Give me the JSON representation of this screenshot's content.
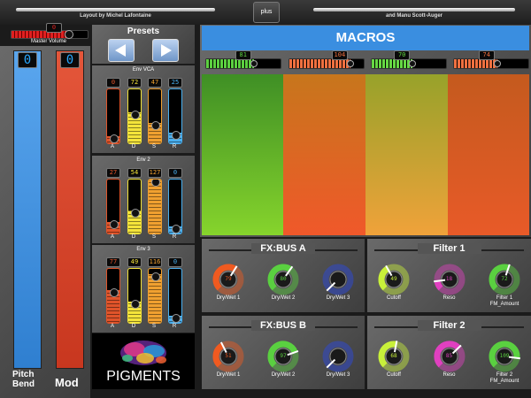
{
  "header": {
    "left_text": "Layout by Michel Lafontaine",
    "right_text": "and Manu Scott-Auger",
    "plus_label": "plus"
  },
  "master": {
    "label": "Master Volume",
    "value": "0",
    "fraction": 0.75
  },
  "pitch": {
    "value": "0",
    "label_line1": "Pitch",
    "label_line2": "Bend",
    "color": "#3b8fdc"
  },
  "mod": {
    "value": "0",
    "label": "Mod",
    "color": "#d8472e"
  },
  "presets": {
    "title": "Presets",
    "prev_icon": "arrow-left-icon",
    "next_icon": "arrow-right-icon"
  },
  "envelopes": [
    {
      "title": "Env VCA",
      "faders": [
        {
          "letter": "A",
          "value": "0",
          "fraction": 0.0,
          "color": "#e0542a"
        },
        {
          "letter": "D",
          "value": "72",
          "fraction": 0.57,
          "color": "#f4e43a"
        },
        {
          "letter": "S",
          "value": "47",
          "fraction": 0.37,
          "color": "#f0a030"
        },
        {
          "letter": "R",
          "value": "25",
          "fraction": 0.2,
          "color": "#4ab0f0"
        }
      ]
    },
    {
      "title": "Env 2",
      "faders": [
        {
          "letter": "A",
          "value": "27",
          "fraction": 0.21,
          "color": "#e0542a"
        },
        {
          "letter": "D",
          "value": "54",
          "fraction": 0.43,
          "color": "#f4e43a"
        },
        {
          "letter": "S",
          "value": "127",
          "fraction": 1.0,
          "color": "#f0a030"
        },
        {
          "letter": "R",
          "value": "0",
          "fraction": 0.0,
          "color": "#4ab0f0"
        }
      ]
    },
    {
      "title": "Env 3",
      "faders": [
        {
          "letter": "A",
          "value": "77",
          "fraction": 0.61,
          "color": "#e0542a"
        },
        {
          "letter": "D",
          "value": "49",
          "fraction": 0.39,
          "color": "#f4e43a"
        },
        {
          "letter": "S",
          "value": "116",
          "fraction": 0.91,
          "color": "#f0a030"
        },
        {
          "letter": "R",
          "value": "0",
          "fraction": 0.0,
          "color": "#4ab0f0"
        }
      ]
    }
  ],
  "logo": {
    "text": "PIGMENTS"
  },
  "macros": {
    "title": "MACROS",
    "title_bg": "#3a8ee0",
    "items": [
      {
        "value": "81",
        "fraction": 0.64,
        "color": "#5cd040"
      },
      {
        "value": "104",
        "fraction": 0.82,
        "color": "#f07040"
      },
      {
        "value": "70",
        "fraction": 0.55,
        "color": "#66d844"
      },
      {
        "value": "74",
        "fraction": 0.58,
        "color": "#f07040"
      }
    ],
    "pads": [
      {
        "top": "#3f8f25",
        "bottom": "#86d42c"
      },
      {
        "top": "#c7761c",
        "bottom": "#f0582a"
      },
      {
        "top": "#97a22a",
        "bottom": "#f0a23a"
      },
      {
        "top": "#c45a1e",
        "bottom": "#e85a28"
      }
    ]
  },
  "fx_bus_a": {
    "title": "FX:BUS A",
    "knobs": [
      {
        "label": "Dry/Wet 1",
        "value": "79",
        "fraction": 0.62,
        "color": "#f05a20"
      },
      {
        "label": "Dry/Wet 2",
        "value": "80",
        "fraction": 0.63,
        "color": "#5ad040"
      },
      {
        "label": "Dry/Wet 3",
        "value": "",
        "fraction": 0.0,
        "color": "#2a4ae8"
      }
    ]
  },
  "filter_1": {
    "title": "Filter 1",
    "knobs": [
      {
        "label": "Cutoff",
        "value": "49",
        "fraction": 0.39,
        "color": "#c8f03a"
      },
      {
        "label": "Reso",
        "value": "18",
        "fraction": 0.14,
        "color": "#e040c0"
      },
      {
        "label": "Filter 1 FM_Amount",
        "value": "72",
        "fraction": 0.57,
        "color": "#5ad040"
      }
    ]
  },
  "fx_bus_b": {
    "title": "FX:BUS B",
    "knobs": [
      {
        "label": "Dry/Wet 1",
        "value": "51",
        "fraction": 0.4,
        "color": "#f05a20"
      },
      {
        "label": "Dry/Wet 2",
        "value": "97",
        "fraction": 0.76,
        "color": "#5ad040"
      },
      {
        "label": "Dry/Wet 3",
        "value": "",
        "fraction": 0.0,
        "color": "#2a4ae8"
      }
    ]
  },
  "filter_2": {
    "title": "Filter 2",
    "knobs": [
      {
        "label": "Cutoff",
        "value": "68",
        "fraction": 0.54,
        "color": "#c8f03a"
      },
      {
        "label": "Reso",
        "value": "85",
        "fraction": 0.67,
        "color": "#e040c0"
      },
      {
        "label": "Filter 2 FM_Amount",
        "value": "109",
        "fraction": 0.86,
        "color": "#5ad040"
      }
    ]
  }
}
